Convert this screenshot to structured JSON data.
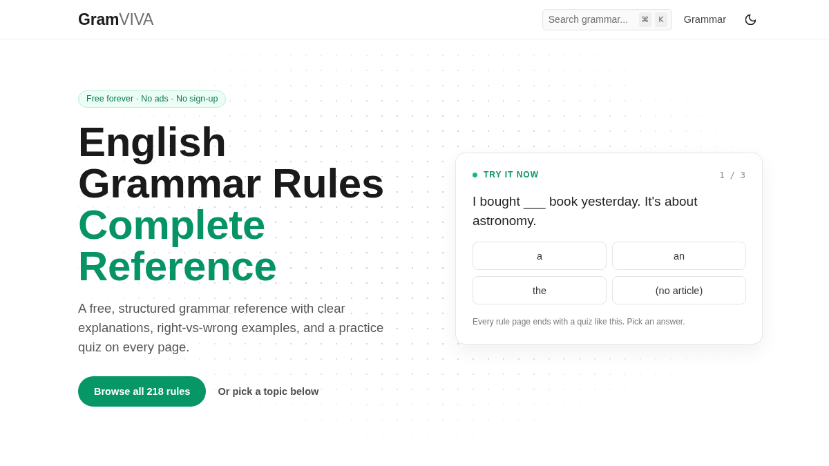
{
  "header": {
    "logo": {
      "strong": "Gram",
      "light": "VIVA"
    },
    "search": {
      "placeholder": "Search grammar...",
      "keys": [
        "⌘",
        "K"
      ]
    },
    "nav": [
      {
        "label": "Grammar"
      }
    ]
  },
  "hero": {
    "badge": "Free forever · No ads · No sign-up",
    "headline": [
      {
        "text": "English Grammar Rules",
        "accent": false
      },
      {
        "text": "Complete Reference",
        "accent": true
      }
    ],
    "intro": "A free, structured grammar reference with clear explanations, right-vs-wrong examples, and a practice quiz on every page.",
    "primary_button": "Browse all 218 rules",
    "secondary_link": "Or pick a topic below"
  },
  "quiz": {
    "label": "TRY IT NOW",
    "counter": "1 / 3",
    "question": "I bought ___ book yesterday. It's about astronomy.",
    "options": [
      {
        "label": "a",
        "selected": false
      },
      {
        "label": "an",
        "selected": false
      },
      {
        "label": "the",
        "selected": false
      },
      {
        "label": "(no article)",
        "selected": false
      }
    ],
    "hint": "Every rule page ends with a quiz like this. Pick an answer."
  }
}
